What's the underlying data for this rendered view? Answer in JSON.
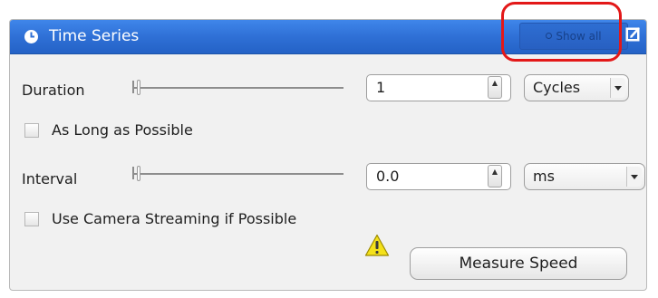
{
  "panel": {
    "title": "Time Series",
    "title_icon": "clock-icon",
    "show_all_label": "Show all",
    "edit_icon": "edit-checkbox-icon"
  },
  "duration": {
    "label": "Duration",
    "value": "1",
    "unit": "Cycles"
  },
  "as_long_as_possible": {
    "label": "As Long as Possible",
    "checked": false
  },
  "interval": {
    "label": "Interval",
    "value": "0.0",
    "unit": "ms"
  },
  "camera_streaming": {
    "label": "Use Camera Streaming if Possible",
    "checked": false
  },
  "measure_speed": {
    "label": "Measure Speed",
    "icon": "warning-icon"
  },
  "colors": {
    "titlebar_blue": "#2f70d6",
    "highlight_red": "#e31818",
    "warning_yellow": "#f4e11a"
  }
}
